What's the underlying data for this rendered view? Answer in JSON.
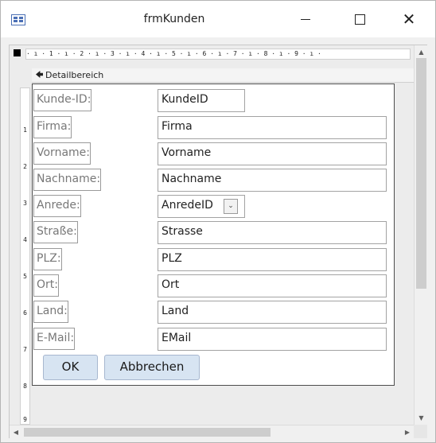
{
  "window": {
    "title": "frmKunden",
    "icon": "form-icon",
    "controls": [
      "minimize-icon",
      "maximize-icon",
      "close-icon"
    ]
  },
  "ruler": {
    "horizontal": "· ı · 1 · ı · 2 · ı · 3 · ı · 4 · ı · 5 · ı · 6 · ı · 7 · ı · 8 · ı · 9 · ı ·",
    "vertical": [
      "1",
      "2",
      "3",
      "4",
      "5",
      "6",
      "7",
      "8",
      "9"
    ]
  },
  "section": {
    "label": "Detailbereich",
    "icon": "section-arrow-icon"
  },
  "fields": [
    {
      "label": "Kunde-ID:",
      "value": "KundeID"
    },
    {
      "label": "Firma:",
      "value": "Firma"
    },
    {
      "label": "Vorname:",
      "value": "Vorname"
    },
    {
      "label": "Nachname:",
      "value": "Nachname"
    },
    {
      "label": "Anrede:",
      "value": "AnredeID"
    },
    {
      "label": "Straße:",
      "value": "Strasse"
    },
    {
      "label": "PLZ:",
      "value": "PLZ"
    },
    {
      "label": "Ort:",
      "value": "Ort"
    },
    {
      "label": "Land:",
      "value": "Land"
    },
    {
      "label": "E-Mail:",
      "value": "EMail"
    }
  ],
  "buttons": {
    "ok": "OK",
    "cancel": "Abbrechen"
  }
}
